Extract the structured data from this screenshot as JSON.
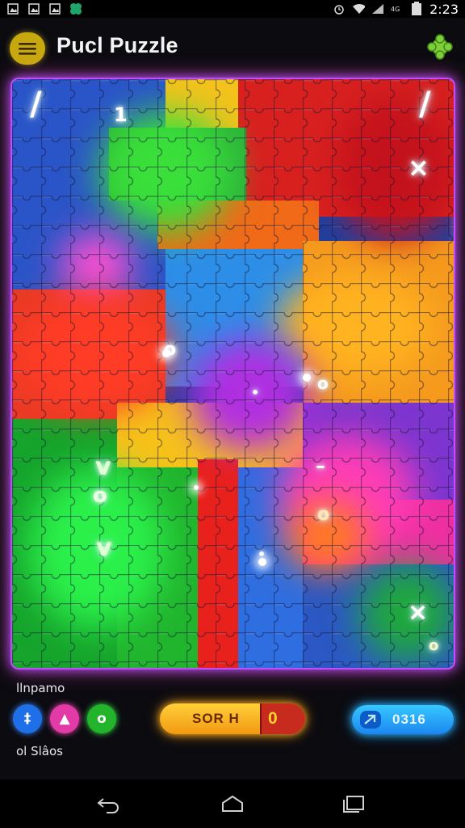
{
  "status_bar": {
    "time": "2:23",
    "icons": [
      "image-icon",
      "image-icon",
      "image-icon",
      "clover-icon",
      "alarm-icon",
      "wifi-icon",
      "signal-icon",
      "data-icon",
      "battery-icon"
    ]
  },
  "header": {
    "title": "Pucl Puzzle",
    "menu_icon": "hamburger-icon",
    "puzzle_icon": "puzzle-piece-icon"
  },
  "board": {
    "glyphs": [
      "/",
      "1",
      "/",
      "×",
      "o",
      "o",
      "•",
      "v",
      "o",
      "v",
      "•",
      "–",
      "o",
      "×",
      "o"
    ]
  },
  "controls": {
    "label_top": "llnpamo",
    "label_bottom": "ol Slâos",
    "circle_buttons": [
      {
        "symbol": "‡",
        "color": "#1f6fe8"
      },
      {
        "symbol": "▲",
        "color": "#e23aa7"
      },
      {
        "symbol": "o",
        "color": "#23b42b"
      }
    ],
    "score_label": "SOR  H",
    "score_value": "0",
    "timer_value": "0316"
  },
  "colors": {
    "accent_gold": "#c7a90f",
    "border_glow": "#c24cff",
    "score_orange": "#f29a12",
    "timer_blue": "#1c86f0"
  }
}
